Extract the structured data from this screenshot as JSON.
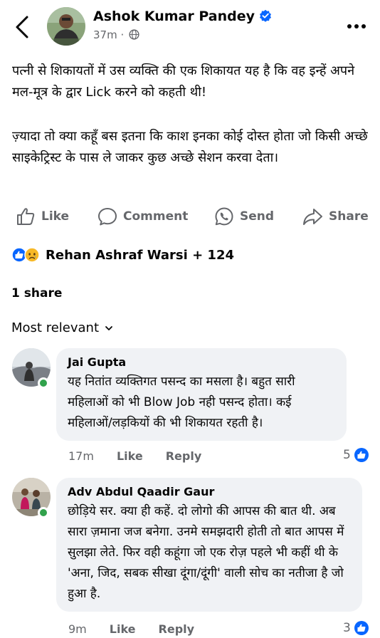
{
  "header": {
    "author_name": "Ashok Kumar Pandey",
    "time": "37m",
    "separator": "·"
  },
  "post": {
    "paragraph_1": "पत्नी से शिकायतों में उस व्यक्ति की एक शिकायत यह है कि वह इन्हें अपने मल-मूत्र के द्वार Lick करने को कहती थी!",
    "paragraph_2": "ज़्यादा तो क्या कहूँ बस इतना कि काश इनका कोई दोस्त होता जो किसी अच्छे साइकेट्रिस्ट के पास ले जाकर कुछ अच्छे सेशन करवा देता।"
  },
  "actions": {
    "like": "Like",
    "comment": "Comment",
    "send": "Send",
    "share": "Share"
  },
  "reactions": {
    "summary": "Rehan Ashraf Warsi + 124"
  },
  "shares": "1 share",
  "sort_label": "Most relevant",
  "colors": {
    "brand_blue": "#0866ff",
    "online_green": "#31a24c",
    "meta_gray": "#65676b",
    "bubble_bg": "#f0f2f5"
  },
  "comments": [
    {
      "author": "Jai Gupta",
      "text": "यह नितांत व्यक्तिगत पसन्द का मसला है। बहुत सारी महिलाओं को भी Blow Job नही पसन्द होता। कई महिलाओं/लड़कियों की भी शिकायत रहती है।",
      "time": "17m",
      "like": "Like",
      "reply": "Reply",
      "reaction_count": "5"
    },
    {
      "author": "Adv Abdul Qaadir Gaur",
      "text": "छोड़िये सर. क्या ही कहें. दो लोगो की आपस की बात थी. अब सारा ज़माना जज बनेगा. उनमे समझदारी होती तो बात आपस में सुलझा लेते. फिर वही कहूंगा जो एक रोज़ पहले भी कहीं थी के 'अना, जिद, सबक सीखा दूंगा/दूंगी' वाली सोच का नतीजा है जो हुआ है.",
      "time": "9m",
      "like": "Like",
      "reply": "Reply",
      "reaction_count": "3"
    }
  ]
}
